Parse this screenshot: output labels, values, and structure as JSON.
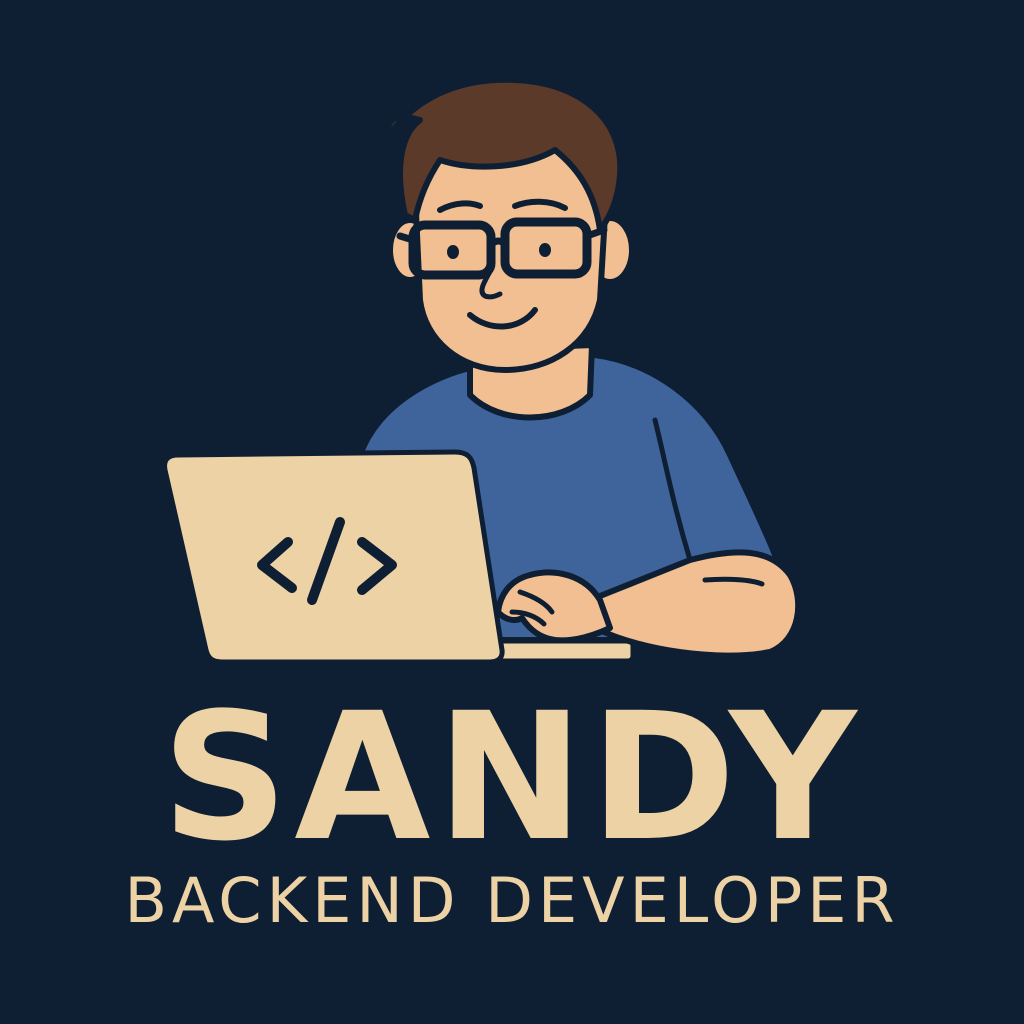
{
  "brand": {
    "name": "SANDY",
    "role": "BACKEND DEVELOPER"
  },
  "illustration": {
    "subject": "developer-avatar",
    "screen_icon": "</>"
  },
  "colors": {
    "background": "#0f1f33",
    "text_accent": "#ecd2a5",
    "skin": "#f1bf91",
    "hair": "#5b3a2a",
    "shirt": "#3f649c",
    "laptop": "#ecd2a5",
    "outline": "#0f1f33"
  }
}
